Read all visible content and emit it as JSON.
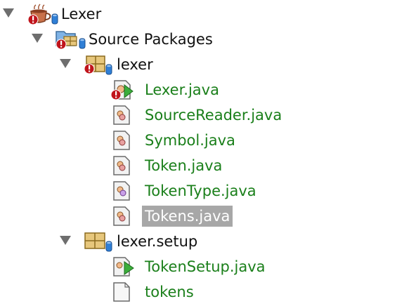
{
  "project": {
    "label": "Lexer",
    "source_packages": {
      "label": "Source Packages",
      "packages": [
        {
          "label": "lexer",
          "files": [
            {
              "label": "Lexer.java",
              "icon": "java-main-class-icon",
              "error": true
            },
            {
              "label": "SourceReader.java",
              "icon": "java-class-icon"
            },
            {
              "label": "Symbol.java",
              "icon": "java-class-icon"
            },
            {
              "label": "Token.java",
              "icon": "java-class-icon"
            },
            {
              "label": "TokenType.java",
              "icon": "java-enum-icon"
            },
            {
              "label": "Tokens.java",
              "icon": "java-class-icon",
              "selected": true
            }
          ]
        },
        {
          "label": "lexer.setup",
          "files": [
            {
              "label": "TokenSetup.java",
              "icon": "java-main-class-icon"
            },
            {
              "label": "tokens",
              "icon": "plain-file-icon"
            }
          ]
        }
      ]
    }
  },
  "colors": {
    "java_file_text": "#1a7f1a",
    "selection_bg": "#a7a7a7",
    "error_badge": "#c0141b",
    "db_badge": "#2f7fd6",
    "package_fill": "#e7c77c"
  }
}
